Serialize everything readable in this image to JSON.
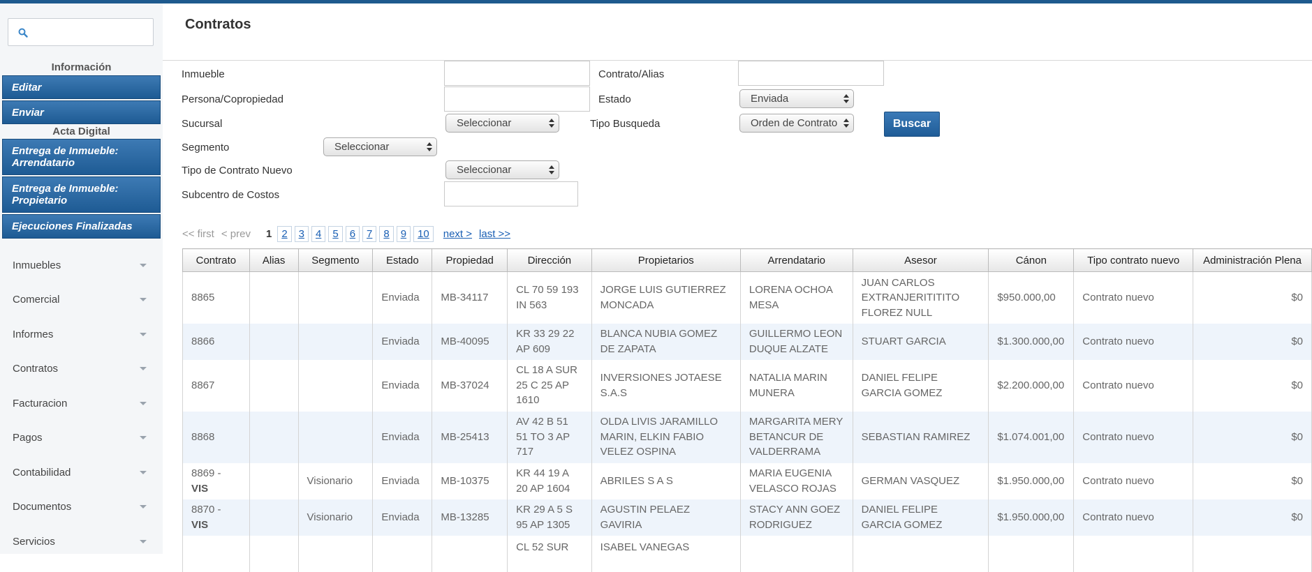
{
  "sidebar": {
    "search_placeholder": "",
    "sections": {
      "informacion": "Información",
      "acta_digital": "Acta Digital"
    },
    "buttons": {
      "editar": "Editar",
      "enviar": "Enviar",
      "entrega_arrendatario_1": "Entrega de Inmueble:",
      "entrega_arrendatario_2": "Arrendatario",
      "entrega_propietario_1": "Entrega de Inmueble:",
      "entrega_propietario_2": "Propietario",
      "ejecuciones": "Ejecuciones Finalizadas"
    },
    "nav": [
      "Inmuebles",
      "Comercial",
      "Informes",
      "Contratos",
      "Facturacion",
      "Pagos",
      "Contabilidad",
      "Documentos",
      "Servicios"
    ]
  },
  "page": {
    "title": "Contratos"
  },
  "filters": {
    "inmueble": "Inmueble",
    "contrato_alias": "Contrato/Alias",
    "persona": "Persona/Copropiedad",
    "estado": "Estado",
    "estado_value": "Enviada",
    "sucursal": "Sucursal",
    "sucursal_value": "Seleccionar",
    "tipo_busqueda": "Tipo Busqueda",
    "tipo_busqueda_value": "Orden de Contrato",
    "segmento": "Segmento",
    "segmento_value": "Seleccionar",
    "tipo_contrato": "Tipo de Contrato Nuevo",
    "tipo_contrato_value": "Seleccionar",
    "subcentro": "Subcentro de Costos",
    "buscar": "Buscar"
  },
  "pager": {
    "first": "<< first",
    "prev": "< prev",
    "current": "1",
    "pages": [
      "2",
      "3",
      "4",
      "5",
      "6",
      "7",
      "8",
      "9",
      "10"
    ],
    "next": "next >",
    "last": "last >>"
  },
  "table": {
    "headers": [
      "Contrato",
      "Alias",
      "Segmento",
      "Estado",
      "Propiedad",
      "Dirección",
      "Propietarios",
      "Arrendatario",
      "Asesor",
      "Cánon",
      "Tipo contrato nuevo",
      "Administración Plena"
    ],
    "rows": [
      {
        "contrato": "8865",
        "vis": "",
        "alias": "",
        "segmento": "",
        "estado": "Enviada",
        "propiedad": "MB-34117",
        "direccion": "CL 70 59 193 IN 563",
        "propietarios": "JORGE LUIS GUTIERREZ MONCADA",
        "arrendatario": "LORENA OCHOA MESA",
        "asesor": "JUAN CARLOS EXTRANJERITITITO FLOREZ NULL",
        "canon": "$950.000,00",
        "tipo": "Contrato nuevo",
        "admin": "$0"
      },
      {
        "contrato": "8866",
        "vis": "",
        "alias": "",
        "segmento": "",
        "estado": "Enviada",
        "propiedad": "MB-40095",
        "direccion": "KR 33 29 22 AP 609",
        "propietarios": "BLANCA NUBIA GOMEZ DE ZAPATA",
        "arrendatario": "GUILLERMO LEON DUQUE ALZATE",
        "asesor": "STUART GARCIA",
        "canon": "$1.300.000,00",
        "tipo": "Contrato nuevo",
        "admin": "$0"
      },
      {
        "contrato": "8867",
        "vis": "",
        "alias": "",
        "segmento": "",
        "estado": "Enviada",
        "propiedad": "MB-37024",
        "direccion": "CL 18 A SUR 25 C 25 AP 1610",
        "propietarios": "INVERSIONES JOTAESE S.A.S",
        "arrendatario": "NATALIA MARIN MUNERA",
        "asesor": "DANIEL FELIPE GARCIA GOMEZ",
        "canon": "$2.200.000,00",
        "tipo": "Contrato nuevo",
        "admin": "$0"
      },
      {
        "contrato": "8868",
        "vis": "",
        "alias": "",
        "segmento": "",
        "estado": "Enviada",
        "propiedad": "MB-25413",
        "direccion": "AV 42 B 51 51 TO 3 AP 717",
        "propietarios": "OLDA LIVIS JARAMILLO MARIN, ELKIN FABIO VELEZ OSPINA",
        "arrendatario": "MARGARITA MERY BETANCUR DE VALDERRAMA",
        "asesor": "SEBASTIAN RAMIREZ",
        "canon": "$1.074.001,00",
        "tipo": "Contrato nuevo",
        "admin": "$0"
      },
      {
        "contrato": "8869 -",
        "vis": "VIS",
        "alias": "",
        "segmento": "Visionario",
        "estado": "Enviada",
        "propiedad": "MB-10375",
        "direccion": "KR 44 19 A 20 AP 1604",
        "propietarios": "ABRILES S A S",
        "arrendatario": "MARIA EUGENIA VELASCO ROJAS",
        "asesor": "GERMAN VASQUEZ",
        "canon": "$1.950.000,00",
        "tipo": "Contrato nuevo",
        "admin": "$0"
      },
      {
        "contrato": "8870 -",
        "vis": "VIS",
        "alias": "",
        "segmento": "Visionario",
        "estado": "Enviada",
        "propiedad": "MB-13285",
        "direccion": "KR 29 A 5 S 95 AP 1305",
        "propietarios": "AGUSTIN PELAEZ GAVIRIA",
        "arrendatario": "STACY ANN GOEZ RODRIGUEZ",
        "asesor": "DANIEL FELIPE GARCIA GOMEZ",
        "canon": "$1.950.000,00",
        "tipo": "Contrato nuevo",
        "admin": "$0"
      },
      {
        "contrato": "",
        "vis": "",
        "alias": "",
        "segmento": "",
        "estado": "",
        "propiedad": "",
        "direccion": "CL 52 SUR",
        "propietarios": "ISABEL VANEGAS",
        "arrendatario": "",
        "asesor": "",
        "canon": "",
        "tipo": "",
        "admin": ""
      }
    ]
  }
}
